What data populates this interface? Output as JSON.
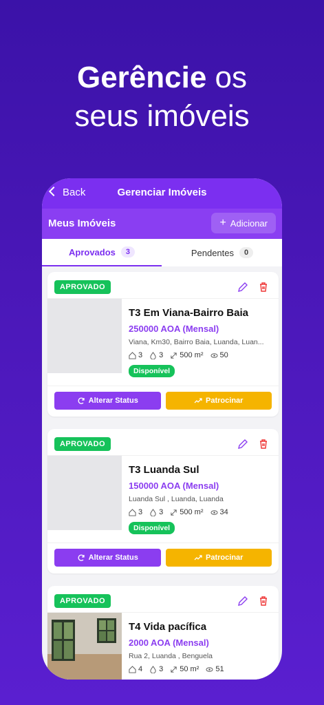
{
  "headline": {
    "bold": "Gerêncie",
    "rest_line1": " os",
    "line2": "seus imóveis"
  },
  "topbar": {
    "back_label": "Back",
    "title": "Gerenciar Imóveis"
  },
  "section": {
    "title": "Meus Imóveis",
    "add_label": "Adicionar"
  },
  "tabs": [
    {
      "label": "Aprovados",
      "count": "3"
    },
    {
      "label": "Pendentes",
      "count": "0"
    }
  ],
  "listings": [
    {
      "badge": "APROVADO",
      "name": "T3 Em Viana-Bairro Baia",
      "price": "250000 AOA (Mensal)",
      "address": "Viana, Km30, Bairro Baia, Luanda, Luan...",
      "rooms": "3",
      "baths": "3",
      "area": "500 m²",
      "views": "50",
      "status": "Disponível",
      "btn_status": "Alterar Status",
      "btn_sponsor": "Patrocinar"
    },
    {
      "badge": "APROVADO",
      "name": "T3 Luanda Sul",
      "price": "150000 AOA (Mensal)",
      "address": "Luanda Sul , Luanda, Luanda",
      "rooms": "3",
      "baths": "3",
      "area": "500 m²",
      "views": "34",
      "status": "Disponível",
      "btn_status": "Alterar Status",
      "btn_sponsor": "Patrocinar"
    },
    {
      "badge": "APROVADO",
      "name": "T4 Vida pacífica",
      "price": "2000 AOA (Mensal)",
      "address": "Rua 2, Luanda , Benguela",
      "rooms": "4",
      "baths": "3",
      "area": "50 m²",
      "views": "51"
    }
  ],
  "colors": {
    "accent": "#7b2ff0",
    "green": "#16c25a",
    "yellow": "#f5b400",
    "bg": "#4a17b8"
  }
}
